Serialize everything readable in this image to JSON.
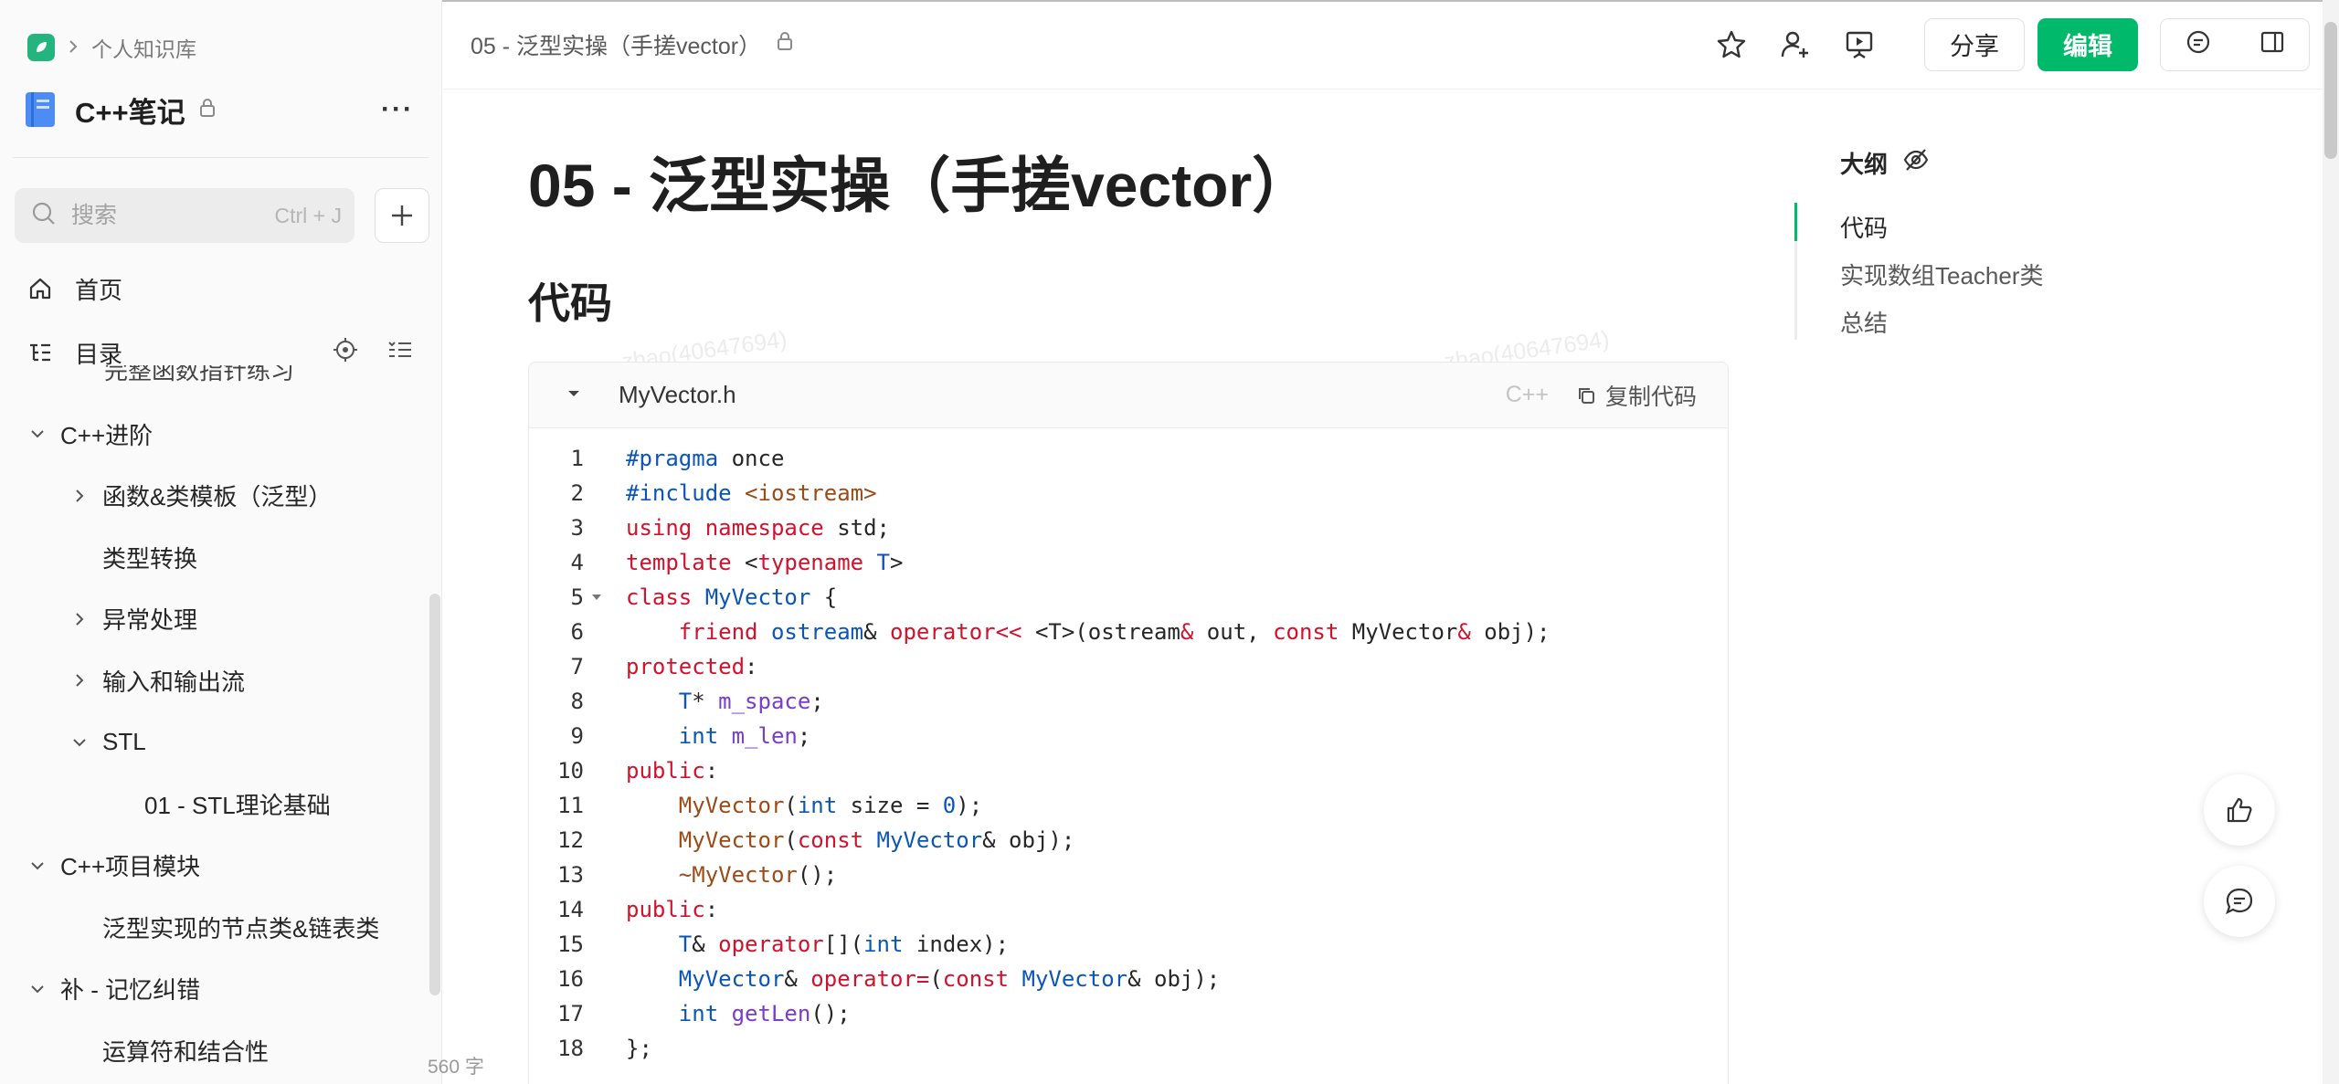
{
  "breadcrumb": {
    "space": "个人知识库"
  },
  "book": {
    "title": "C++笔记"
  },
  "search": {
    "placeholder": "搜索",
    "shortcut": "Ctrl + J"
  },
  "nav": {
    "home": "首页",
    "toc": "目录"
  },
  "tree": {
    "clipped": "完整函数指针练习",
    "items": [
      {
        "label": "C++进阶",
        "level": 0,
        "arrow": "down"
      },
      {
        "label": "函数&类模板（泛型）",
        "level": 1,
        "arrow": "right"
      },
      {
        "label": "类型转换",
        "level": 1,
        "arrow": "none"
      },
      {
        "label": "异常处理",
        "level": 1,
        "arrow": "right"
      },
      {
        "label": "输入和输出流",
        "level": 1,
        "arrow": "right"
      },
      {
        "label": "STL",
        "level": 1,
        "arrow": "down"
      },
      {
        "label": "01 - STL理论基础",
        "level": 2,
        "arrow": "none"
      },
      {
        "label": "C++项目模块",
        "level": 0,
        "arrow": "down"
      },
      {
        "label": "泛型实现的节点类&链表类",
        "level": 1,
        "arrow": "none"
      },
      {
        "label": "补 - 记忆纠错",
        "level": 0,
        "arrow": "down"
      },
      {
        "label": "运算符和结合性",
        "level": 1,
        "arrow": "none"
      }
    ]
  },
  "word_count": "560 字",
  "topbar": {
    "doc_crumb": "05 - 泛型实操（手搓vector）",
    "share": "分享",
    "edit": "编辑"
  },
  "doc": {
    "title": "05 - 泛型实操（手搓vector）",
    "h2": "代码",
    "watermark": "zhao(40647694)"
  },
  "code": {
    "filename": "MyVector.h",
    "lang": "C++",
    "copy": "复制代码",
    "lines": [
      "<span class=\"k-blue\">#pragma</span> once",
      "<span class=\"k-blue\">#include</span> <span class=\"k-brown\">&lt;iostream&gt;</span>",
      "<span class=\"k-red\">using namespace</span> std;",
      "<span class=\"k-red\">template</span> &lt;<span class=\"k-red\">typename</span> <span class=\"k-blue\">T</span>&gt;",
      "<span class=\"k-red\">class</span> <span class=\"k-blue\">MyVector</span> {",
      "    <span class=\"k-red\">friend</span> <span class=\"k-blue\">ostream</span>&amp; <span class=\"k-red\">operator&lt;&lt;</span> &lt;T&gt;(ostream<span class=\"k-red\">&amp;</span> out, <span class=\"k-red\">const</span> MyVector<span class=\"k-red\">&amp;</span> obj);",
      "<span class=\"k-red\">protected</span>:",
      "    <span class=\"k-blue\">T</span>* <span class=\"k-purp\">m_space</span>;",
      "    <span class=\"k-blue\">int</span> <span class=\"k-purp\">m_len</span>;",
      "<span class=\"k-red\">public</span>:",
      "    <span class=\"k-brown\">MyVector</span>(<span class=\"k-blue\">int</span> size = <span class=\"k-num\">0</span>);",
      "    <span class=\"k-brown\">MyVector</span>(<span class=\"k-red\">const</span> <span class=\"k-blue\">MyVector</span>&amp; obj);",
      "    <span class=\"k-brown\">~MyVector</span>();",
      "<span class=\"k-red\">public</span>:",
      "    <span class=\"k-blue\">T</span>&amp; <span class=\"k-red\">operator</span>[](<span class=\"k-blue\">int</span> index);",
      "    <span class=\"k-blue\">MyVector</span>&amp; <span class=\"k-red\">operator=</span>(<span class=\"k-red\">const</span> <span class=\"k-blue\">MyVector</span>&amp; obj);",
      "    <span class=\"k-blue\">int</span> <span class=\"k-purp\">getLen</span>();",
      "};"
    ]
  },
  "outline": {
    "title": "大纲",
    "items": [
      "代码",
      "实现数组Teacher类",
      "总结"
    ]
  },
  "colors": {
    "accent": "#00b96b",
    "keyword": "#d0122d",
    "type": "#0b55b7"
  }
}
